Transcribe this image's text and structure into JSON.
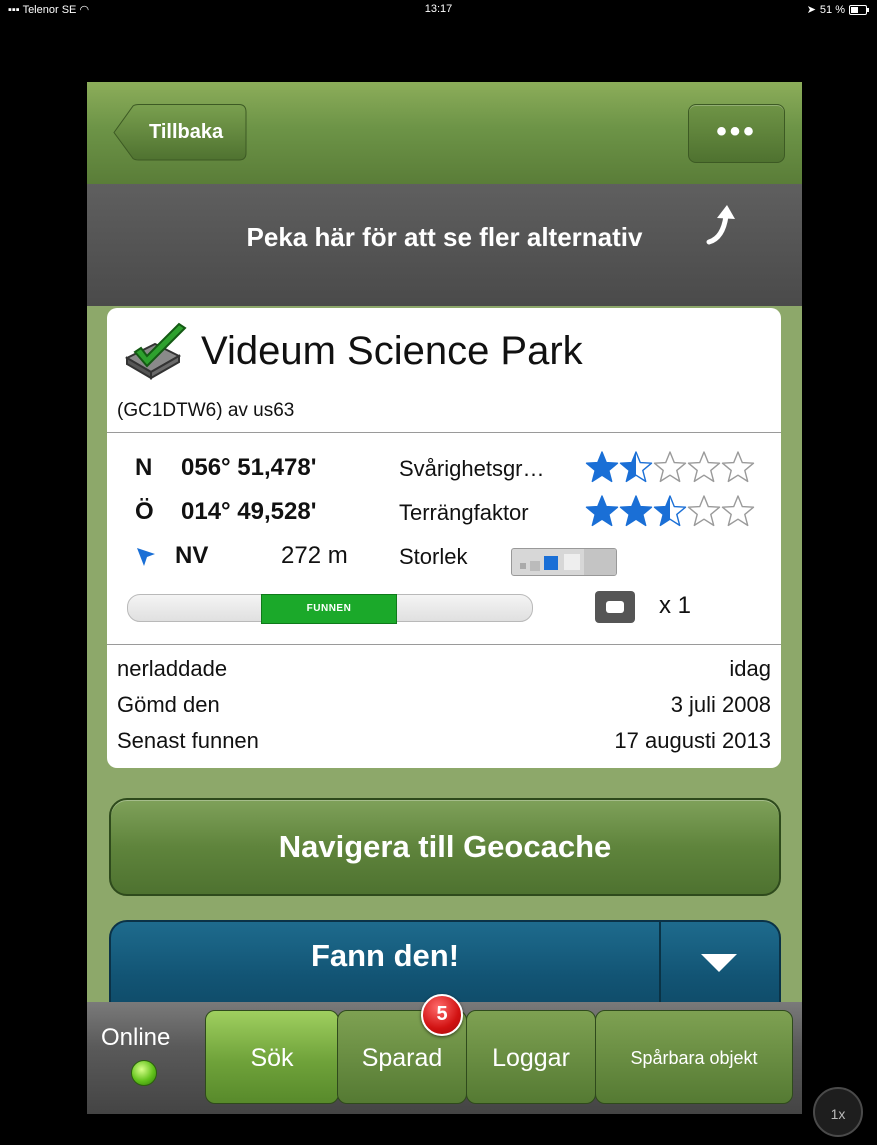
{
  "status_bar": {
    "carrier": "Telenor SE",
    "time": "13:17",
    "battery": "51 %"
  },
  "navbar": {
    "back_label": "Tillbaka",
    "more_label": "•••"
  },
  "hint": {
    "text": "Peka här för att se fler alternativ"
  },
  "cache": {
    "name": "Videum Science Park",
    "code_line": "(GC1DTW6) av us63",
    "lat_dir": "N",
    "lat_val": "056° 51,478'",
    "lon_dir": "Ö",
    "lon_val": "014° 49,528'",
    "difficulty_label": "Svårighetsgr…",
    "difficulty": 1.5,
    "terrain_label": "Terrängfaktor",
    "terrain": 2.5,
    "bearing": "NV",
    "distance": "272 m",
    "size_label": "Storlek",
    "status_badge": "FUNNEN",
    "trackables_count": "x 1",
    "info": [
      {
        "k": "nerladdade",
        "v": "idag"
      },
      {
        "k": "Gömd den",
        "v": "3 juli 2008"
      },
      {
        "k": "Senast funnen",
        "v": "17 augusti 2013"
      }
    ]
  },
  "buttons": {
    "navigate": "Navigera till Geocache",
    "found": "Fann den!"
  },
  "tabbar": {
    "online_label": "Online",
    "tabs": [
      "Sök",
      "Sparad",
      "Loggar",
      "Spårbara objekt"
    ],
    "active_tab": "Sök",
    "saved_badge": "5"
  },
  "zoom": "1x",
  "colors": {
    "accent_green": "#6d9447",
    "found_blue": "#125474",
    "star_blue": "#1a6fd6",
    "found_badge_green": "#1ba92a"
  }
}
